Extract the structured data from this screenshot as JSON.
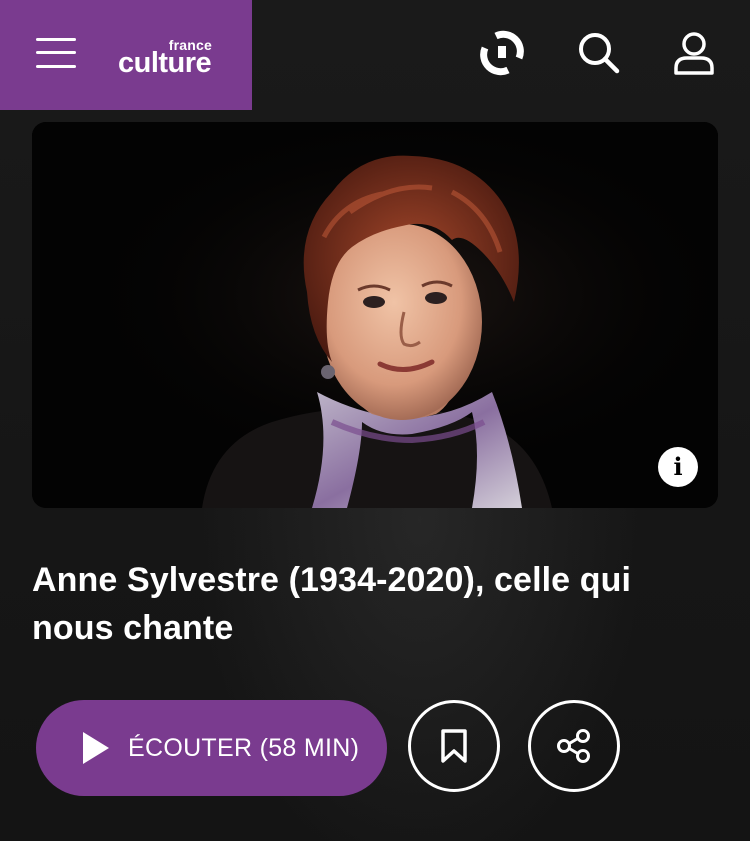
{
  "header": {
    "menu_icon": "hamburger-menu-icon",
    "logo": {
      "small": "france",
      "big": "culture"
    },
    "brand_color": "#7a3b8f",
    "icons": [
      "live-radio-icon",
      "search-icon",
      "user-account-icon"
    ]
  },
  "hero": {
    "image": "portrait-photo",
    "info_icon": "info-icon",
    "info_glyph": "i"
  },
  "episode": {
    "title": "Anne Sylvestre (1934-2020), celle qui nous chante"
  },
  "actions": {
    "play_label": "ÉCOUTER (58 MIN)",
    "play_icon": "play-icon",
    "bookmark_icon": "bookmark-icon",
    "share_icon": "share-icon",
    "accent_color": "#7a3b8f"
  }
}
